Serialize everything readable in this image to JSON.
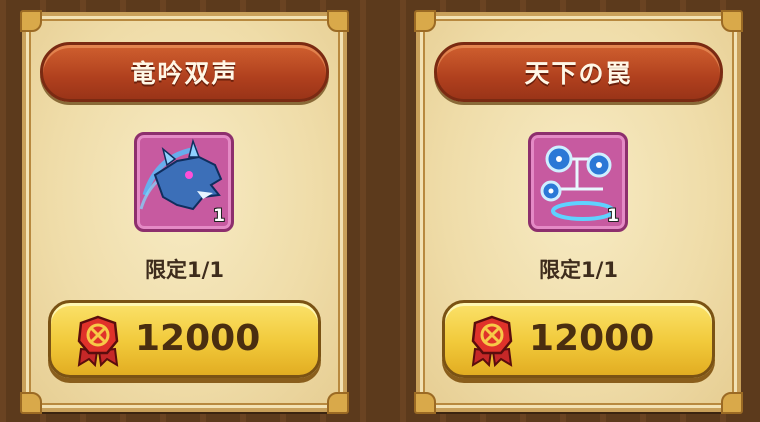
{
  "cards": [
    {
      "title": "竜吟双声",
      "item_icon": "blue-dragon-icon",
      "quantity": "1",
      "limit_text": "限定1/1",
      "currency_icon": "red-medal-coin-icon",
      "price": "12000"
    },
    {
      "title": "天下の罠",
      "item_icon": "blue-orb-trap-icon",
      "quantity": "1",
      "limit_text": "限定1/1",
      "currency_icon": "red-medal-coin-icon",
      "price": "12000"
    }
  ],
  "colors": {
    "banner": "#b0401e",
    "card": "#efdca8",
    "price_button": "#f1c93a",
    "icon_frame": "#c75aa0"
  }
}
